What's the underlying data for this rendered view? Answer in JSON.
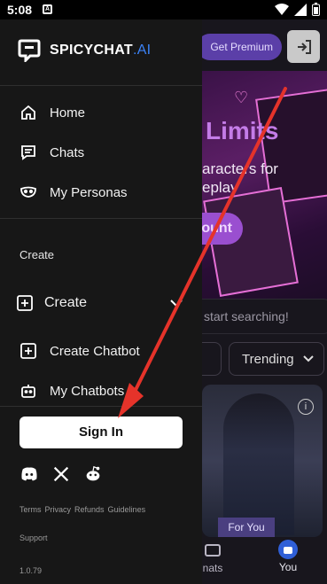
{
  "status_bar": {
    "time": "5:08",
    "notification_icon": "A",
    "icons": [
      "wifi-icon",
      "signal-icon",
      "battery-icon"
    ]
  },
  "background_app": {
    "premium_button": "Get Premium",
    "hero_title": "Limits",
    "hero_subtitle_line1": "aracters for",
    "hero_subtitle_line2": "eplay",
    "hero_cta": "ount",
    "search_placeholder": "start searching!",
    "sort_label": "Trending",
    "card_tag": "For You",
    "card_info": "i",
    "nav": {
      "chats": "nats",
      "you": "You"
    }
  },
  "drawer": {
    "brand": {
      "name": "SPICYCHAT",
      "suffix": ".AI"
    },
    "nav_items": [
      {
        "label": "Home",
        "icon": "home-icon"
      },
      {
        "label": "Chats",
        "icon": "chat-icon"
      },
      {
        "label": "My Personas",
        "icon": "mask-icon"
      }
    ],
    "section_label": "Create",
    "create_dropdown": "Create",
    "create_items": [
      {
        "label": "Create Chatbot",
        "icon": "plus-square-icon"
      },
      {
        "label": "My Chatbots",
        "icon": "robot-icon"
      }
    ],
    "sign_in": "Sign In",
    "socials": [
      "discord-icon",
      "x-icon",
      "reddit-icon"
    ],
    "footer_links": [
      "Terms",
      "Privacy",
      "Refunds",
      "Guidelines"
    ],
    "support": "Support",
    "version": "1.0.79"
  },
  "colors": {
    "drawer_bg": "#171717",
    "accent_blue": "#3b82f6",
    "annotation_arrow": "#e5332a"
  }
}
